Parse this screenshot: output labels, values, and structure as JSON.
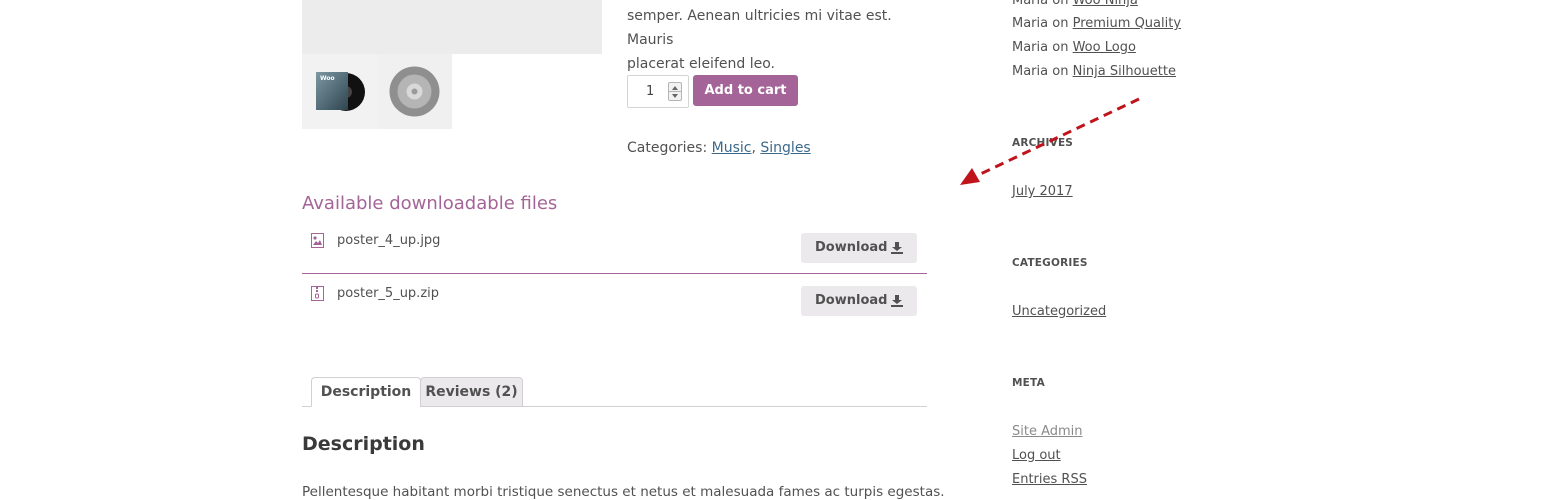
{
  "product": {
    "short_description_line1": "semper. Aenean ultricies mi vitae est. Mauris",
    "short_description_line2": "placerat eleifend leo.",
    "quantity": "1",
    "add_to_cart_label": "Add to cart",
    "categories_label": "Categories:",
    "categories": [
      "Music",
      "Singles"
    ]
  },
  "downloads": {
    "title": "Available downloadable files",
    "files": [
      {
        "name": "poster_4_up.jpg",
        "icon": "image-file-icon",
        "button": "Download"
      },
      {
        "name": "poster_5_up.zip",
        "icon": "zip-file-icon",
        "button": "Download"
      }
    ]
  },
  "tabs": [
    {
      "label": "Description",
      "active": true
    },
    {
      "label": "Reviews (2)",
      "active": false
    }
  ],
  "description": {
    "title": "Description",
    "text": "Pellentesque habitant morbi tristique senectus et netus et malesuada fames ac turpis egestas."
  },
  "sidebar": {
    "recent_comments": [
      {
        "author": "Maria",
        "on": "on",
        "post": "Woo Ninja"
      },
      {
        "author": "Maria",
        "on": "on",
        "post": "Premium Quality"
      },
      {
        "author": "Maria",
        "on": "on",
        "post": "Woo Logo"
      },
      {
        "author": "Maria",
        "on": "on",
        "post": "Ninja Silhouette"
      }
    ],
    "archives": {
      "title": "ARCHIVES",
      "items": [
        "July 2017"
      ]
    },
    "categories": {
      "title": "CATEGORIES",
      "items": [
        "Uncategorized"
      ]
    },
    "meta": {
      "title": "META",
      "items": [
        "Site Admin",
        "Log out",
        "Entries RSS"
      ]
    }
  },
  "colors": {
    "accent": "#a46497",
    "link": "#3d6a8a",
    "annotation_arrow": "#c0141c"
  }
}
